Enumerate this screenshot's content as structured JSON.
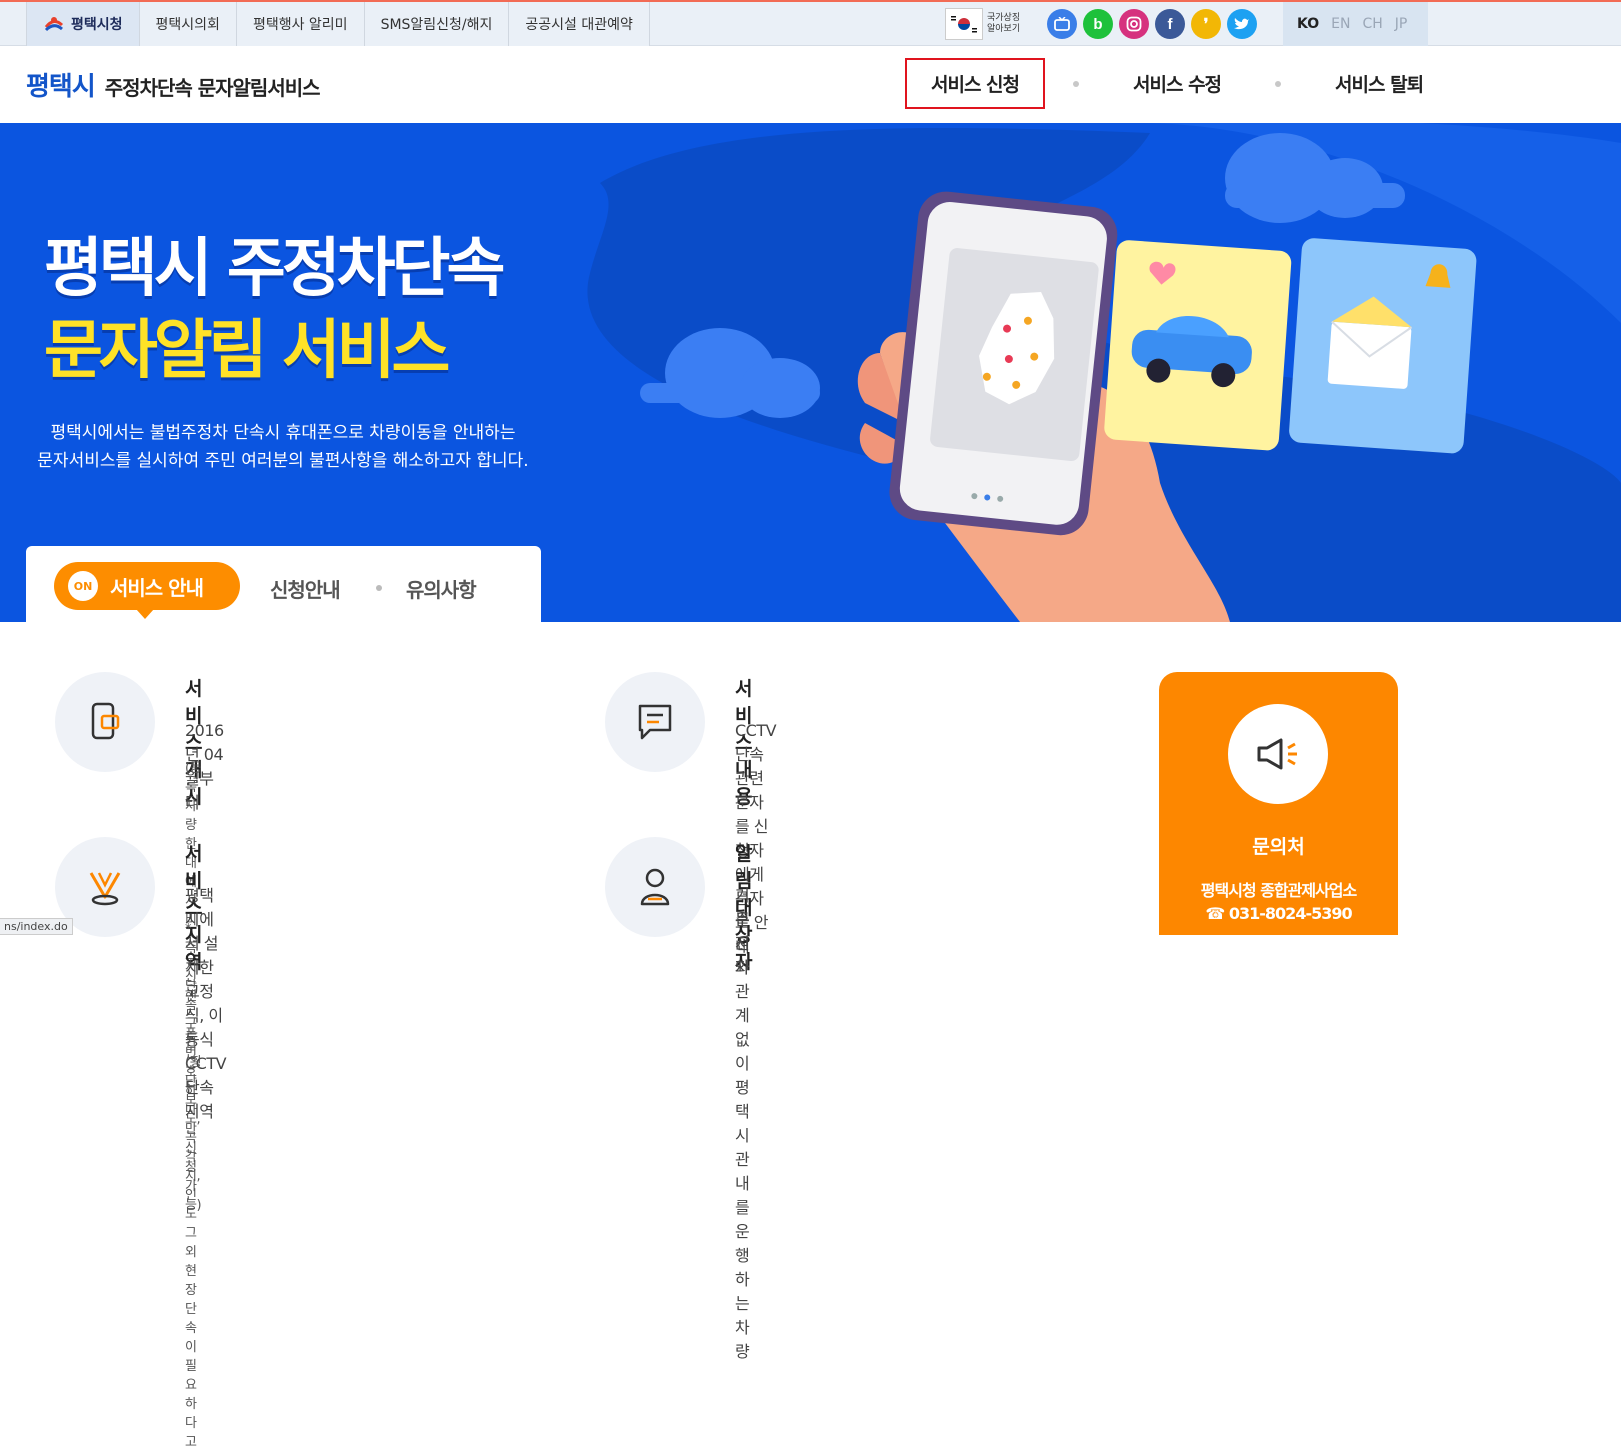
{
  "topbar": {
    "tabs": [
      {
        "label": "평택시청",
        "active": true
      },
      {
        "label": "평택시의회"
      },
      {
        "label": "평택행사 알리미"
      },
      {
        "label": "SMS알림신청/해지"
      },
      {
        "label": "공공시설 대관예약"
      }
    ],
    "national_symbol": "국가상징 알아보기",
    "sns_icons": [
      "tv-icon",
      "blog-icon",
      "instagram-icon",
      "facebook-icon",
      "kakaostory-icon",
      "twitter-icon"
    ],
    "languages": [
      {
        "label": "KO",
        "active": true
      },
      {
        "label": "EN"
      },
      {
        "label": "CH"
      },
      {
        "label": "JP"
      }
    ]
  },
  "header": {
    "city": "평택시",
    "service_name": "주정차단속 문자알림서비스",
    "nav": [
      "서비스 신청",
      "서비스 수정",
      "서비스 탈퇴"
    ]
  },
  "hero": {
    "title_line1": "평택시 주정차단속",
    "title_line2": "문자알림 서비스",
    "desc_line1": "평택시에서는 불법주정차 단속시 휴대폰으로 차량이동을 안내하는",
    "desc_line2": "문자서비스를 실시하여 주민 여러분의 불편사항을 해소하고자 합니다."
  },
  "subtabs": {
    "badge": "ON",
    "active": "서비스 안내",
    "items": [
      "신청안내",
      "유의사항"
    ]
  },
  "info": {
    "start": {
      "title": "서비스 개시",
      "text": "2016년 04월부터",
      "note": "(등록차량 한대에 서비스 수신 핸드폰번호 하나만 신청가능)"
    },
    "content": {
      "title": "서비스 내용",
      "text": "CCTV 단속 관련 문자를 신청자에게 문자로 안내"
    },
    "area": {
      "title": "서비스 지역",
      "text": "평택시에서 설치한 고정식, 이동식 CCTV 단속지역",
      "note": "* 즉시단속구간(횡단보도,곡각지,인도 그외 현장단속이 필요하다고"
    },
    "target": {
      "title": "알림 대상자",
      "text1": "거주지와 관계없이 평택시 관내를 운행하는 차량",
      "text2": "운전자"
    }
  },
  "contact": {
    "title": "문의처",
    "org": "평택시청 종합관제사업소",
    "phone": "☎ 031-8024-5390"
  },
  "status_url": "ns/index.do",
  "colors": {
    "brand_blue": "#1355c9",
    "hero_blue": "#0b55e0",
    "accent_orange": "#fd8700",
    "highlight_red": "#e0141e",
    "hero_yellow": "#ffe227"
  }
}
